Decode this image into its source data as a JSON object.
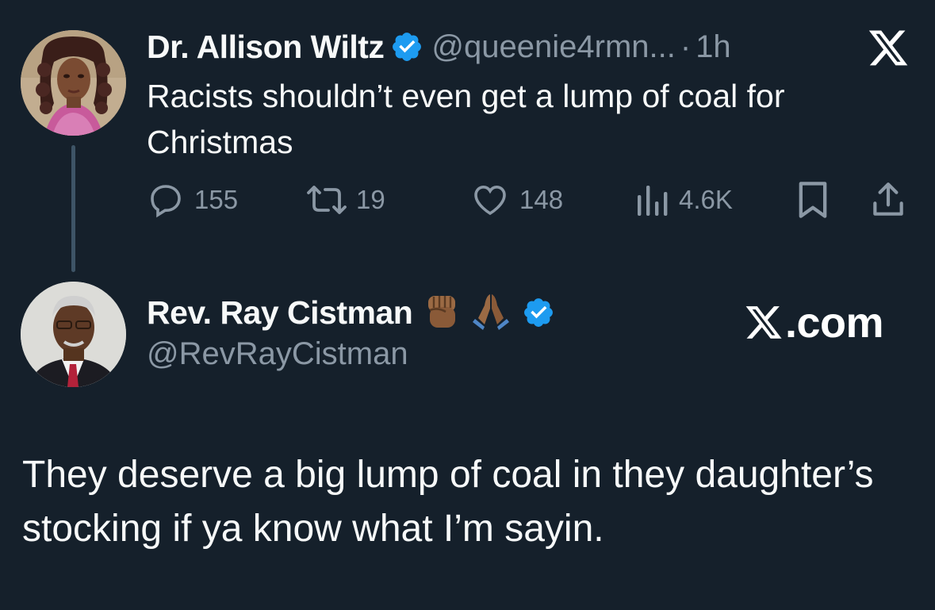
{
  "tweet1": {
    "display_name": "Dr. Allison Wiltz",
    "handle": "@queenie4rmn...",
    "separator": "·",
    "time": "1h",
    "text": "Racists shouldn’t even get a lump of coal for Christmas",
    "replies": "155",
    "reposts": "19",
    "likes": "148",
    "views": "4.6K",
    "avatar_icon": "profile-photo-woman",
    "verified_icon": "verified-badge-icon"
  },
  "tweet2": {
    "display_name": "Rev. Ray Cistman",
    "emojis": [
      "✊🏾",
      "🙏🏾"
    ],
    "handle": "@RevRayCistman",
    "text": "They deserve a big lump of coal in they daughter’s stocking if ya know what I’m sayin.",
    "avatar_icon": "profile-photo-man",
    "verified_icon": "verified-badge-icon"
  },
  "watermark": {
    "text": ".com"
  },
  "colors": {
    "background": "#15202b",
    "text": "#f7f9f9",
    "muted": "#8b98a5",
    "verified_blue": "#1d9bf0"
  }
}
